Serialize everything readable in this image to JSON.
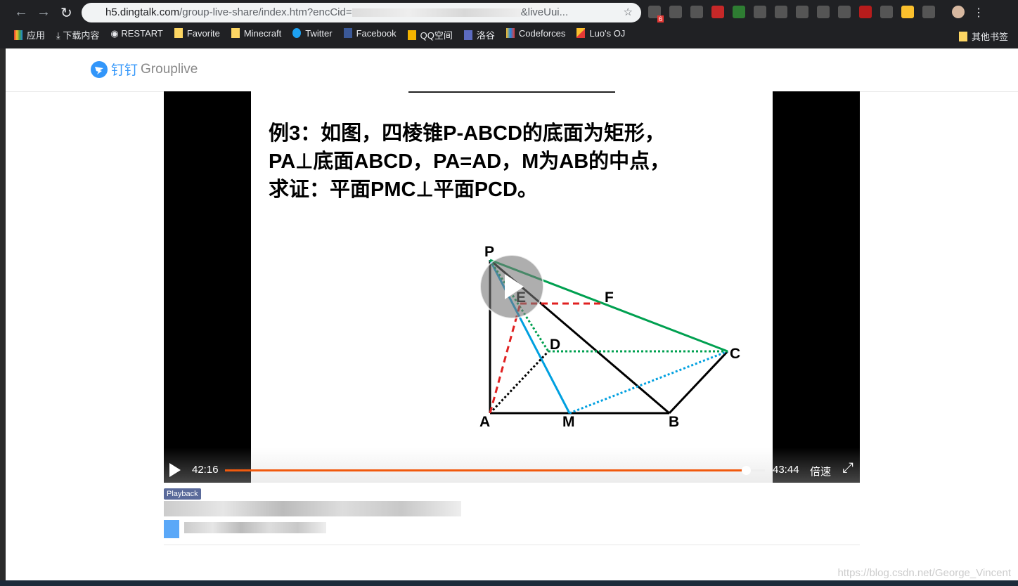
{
  "browser": {
    "url_host": "h5.dingtalk.com",
    "url_path": "/group-live-share/index.htm?encCid=",
    "url_tail": "&liveUui...",
    "extension_badge": "6",
    "bookmarks": [
      "应用",
      "下载内容",
      "RESTART",
      "Favorite",
      "Minecraft",
      "Twitter",
      "Facebook",
      "QQ空间",
      "洛谷",
      "Codeforces",
      "Luo's OJ"
    ],
    "other_bookmarks": "其他书签"
  },
  "header": {
    "logo_cn": "钉钉",
    "logo_en": "Grouplive"
  },
  "slide": {
    "lines": [
      "例3：如图，四棱锥P-ABCD的底面为矩形，",
      "PA⊥底面ABCD，PA=AD，M为AB的中点，",
      "求证：平面PMC⊥平面PCD。"
    ],
    "points": {
      "P": "P",
      "A": "A",
      "M": "M",
      "B": "B",
      "C": "C",
      "D": "D",
      "E": "E",
      "F": "F"
    }
  },
  "player": {
    "current_time": "42:16",
    "duration": "43:44",
    "progress": 0.965,
    "speed_label": "倍速",
    "accent": "#f15a0e"
  },
  "badge": "Playback",
  "watermark": "https://blog.csdn.net/George_Vincent"
}
